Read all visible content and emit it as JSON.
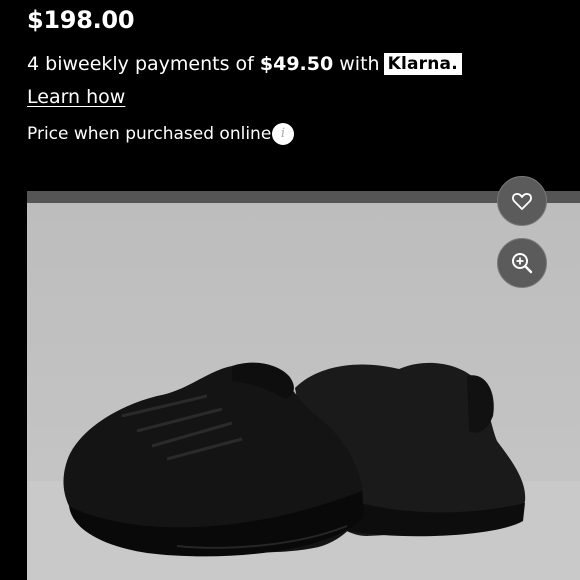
{
  "product": {
    "price": "$198.00",
    "payments_prefix": "4 biweekly payments of ",
    "payments_amount": "$49.50",
    "payments_suffix": " with",
    "provider": "Klarna.",
    "learn_link": "Learn how",
    "price_note": "Price when purchased online"
  },
  "icons": {
    "info": "info-icon",
    "favorite": "heart-icon",
    "zoom": "zoom-in-icon"
  },
  "image": {
    "alt": "Black running sneakers"
  },
  "colors": {
    "background": "#000000",
    "image_bg": "#c6c6c6",
    "button_bg": "#5b5b5b",
    "text": "#ffffff"
  }
}
